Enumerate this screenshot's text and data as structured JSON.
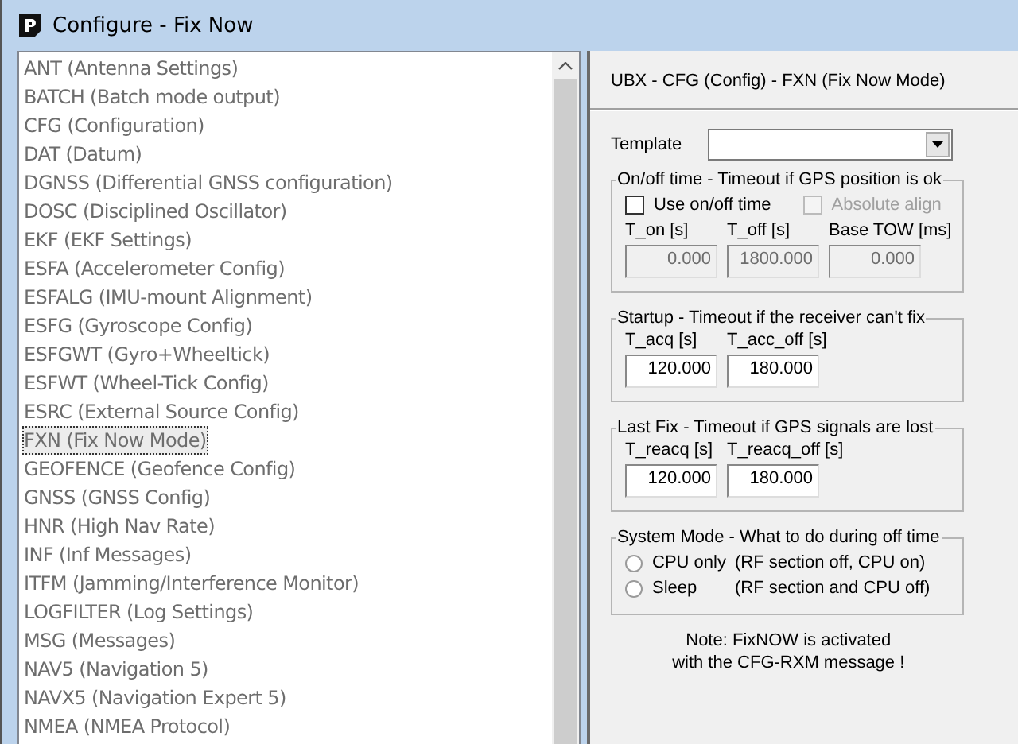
{
  "window": {
    "title": "Configure - Fix Now"
  },
  "messages": [
    {
      "label": "ANT (Antenna Settings)",
      "selected": false
    },
    {
      "label": "BATCH (Batch mode output)",
      "selected": false
    },
    {
      "label": "CFG (Configuration)",
      "selected": false
    },
    {
      "label": "DAT (Datum)",
      "selected": false
    },
    {
      "label": "DGNSS (Differential GNSS configuration)",
      "selected": false
    },
    {
      "label": "DOSC (Disciplined Oscillator)",
      "selected": false
    },
    {
      "label": "EKF (EKF Settings)",
      "selected": false
    },
    {
      "label": "ESFA (Accelerometer Config)",
      "selected": false
    },
    {
      "label": "ESFALG (IMU-mount Alignment)",
      "selected": false
    },
    {
      "label": "ESFG (Gyroscope Config)",
      "selected": false
    },
    {
      "label": "ESFGWT (Gyro+Wheeltick)",
      "selected": false
    },
    {
      "label": "ESFWT (Wheel-Tick Config)",
      "selected": false
    },
    {
      "label": "ESRC (External Source Config)",
      "selected": false
    },
    {
      "label": "FXN (Fix Now Mode)",
      "selected": true
    },
    {
      "label": "GEOFENCE (Geofence Config)",
      "selected": false
    },
    {
      "label": "GNSS (GNSS Config)",
      "selected": false
    },
    {
      "label": "HNR (High Nav Rate)",
      "selected": false
    },
    {
      "label": "INF (Inf Messages)",
      "selected": false
    },
    {
      "label": "ITFM (Jamming/Interference Monitor)",
      "selected": false
    },
    {
      "label": "LOGFILTER (Log Settings)",
      "selected": false
    },
    {
      "label": "MSG (Messages)",
      "selected": false
    },
    {
      "label": "NAV5 (Navigation 5)",
      "selected": false
    },
    {
      "label": "NAVX5 (Navigation Expert 5)",
      "selected": false
    },
    {
      "label": "NMEA (NMEA Protocol)",
      "selected": false
    }
  ],
  "panel": {
    "header": "UBX - CFG (Config) - FXN (Fix Now Mode)",
    "template": {
      "label": "Template"
    },
    "groups": [
      {
        "title": "On/off time - Timeout if GPS position is ok",
        "checkboxes": [
          {
            "label": "Use on/off time",
            "checked": false,
            "disabled": false
          },
          {
            "label": "Absolute align",
            "checked": false,
            "disabled": true
          }
        ],
        "fields": [
          {
            "label": "T_on [s]",
            "value": "0.000",
            "disabled": true
          },
          {
            "label": "T_off [s]",
            "value": "1800.000",
            "disabled": true
          },
          {
            "label": "Base TOW [ms]",
            "value": "0.000",
            "disabled": true
          }
        ]
      },
      {
        "title": "Startup - Timeout if the receiver can't fix",
        "fields": [
          {
            "label": "T_acq [s]",
            "value": "120.000",
            "disabled": false
          },
          {
            "label": "T_acc_off [s]",
            "value": "180.000",
            "disabled": false
          }
        ]
      },
      {
        "title": "Last Fix - Timeout if GPS signals are lost",
        "fields": [
          {
            "label": "T_reacq [s]",
            "value": "120.000",
            "disabled": false
          },
          {
            "label": "T_reacq_off [s]",
            "value": "180.000",
            "disabled": false
          }
        ]
      },
      {
        "title": "System Mode - What to do during off time",
        "options": [
          {
            "label": "CPU only",
            "description": "(RF section off, CPU on)",
            "selected": false
          },
          {
            "label": "Sleep",
            "description": "(RF section and CPU off)",
            "selected": false
          }
        ]
      }
    ],
    "note": [
      "Note: FixNOW is activated",
      "with the CFG-RXM message !"
    ]
  }
}
